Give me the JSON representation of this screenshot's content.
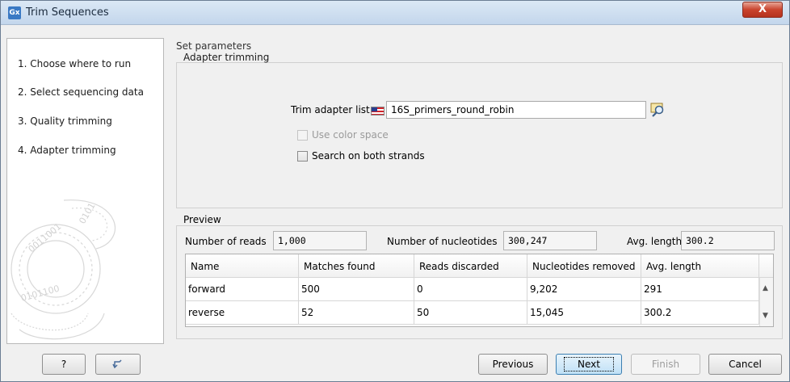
{
  "window": {
    "title": "Trim Sequences",
    "app_icon": "Gx",
    "close_label": "X"
  },
  "sidebar": {
    "steps": [
      {
        "label": "1.  Choose where to run"
      },
      {
        "label": "2.  Select sequencing data"
      },
      {
        "label": "3.  Quality trimming"
      },
      {
        "label": "4.  Adapter trimming"
      }
    ]
  },
  "content": {
    "header": "Set parameters",
    "adapter_group": "Adapter trimming",
    "trim_adapter_label": "Trim adapter list",
    "trim_adapter_value": "16S_primers_round_robin",
    "use_color_space_label": "Use color space",
    "search_both_strands_label": "Search on both strands",
    "preview_group": "Preview",
    "stats": {
      "reads_label": "Number of reads",
      "reads_value": "1,000",
      "nucleotides_label": "Number of nucleotides",
      "nucleotides_value": "300,247",
      "avg_length_label": "Avg. length",
      "avg_length_value": "300.2"
    },
    "table": {
      "headers": [
        "Name",
        "Matches found",
        "Reads discarded",
        "Nucleotides removed",
        "Avg. length"
      ],
      "rows": [
        [
          "forward",
          "500",
          "0",
          "9,202",
          "291"
        ],
        [
          "reverse",
          "52",
          "50",
          "15,045",
          "300.2"
        ]
      ]
    }
  },
  "footer": {
    "help_label": "?",
    "previous_label": "Previous",
    "next_label": "Next",
    "finish_label": "Finish",
    "cancel_label": "Cancel"
  },
  "colors": {
    "title_bar": "#c3d6ec",
    "close_button": "#c9432d",
    "default_button": "#bfe0f6"
  }
}
